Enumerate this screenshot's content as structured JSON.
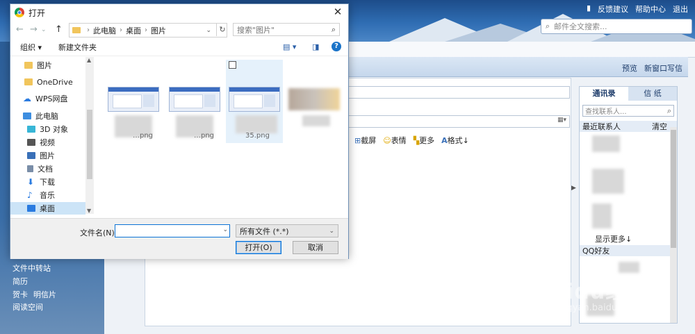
{
  "mail": {
    "header_links": [
      "反馈建议",
      "帮助中心",
      "退出"
    ],
    "search_placeholder": "邮件全文搜索...",
    "toolbar_right": [
      "预览",
      "新窗口写信"
    ],
    "format_tools": [
      "截屏",
      "表情",
      "更多",
      "格式"
    ],
    "left_links": [
      "文件中转站",
      "简历",
      "贺卡",
      "明信片",
      "阅读空间"
    ]
  },
  "contacts_panel": {
    "tabs": [
      "通讯录",
      "信 纸"
    ],
    "search_placeholder": "查找联系人...",
    "recent_label": "最近联系人",
    "clear_label": "清空",
    "show_more": "显示更多↓",
    "qq_friends": "QQ好友"
  },
  "dialog": {
    "title": "打开",
    "path": [
      "此电脑",
      "桌面",
      "图片"
    ],
    "search_placeholder": "搜索\"图片\"",
    "organize": "组织 ▾",
    "new_folder": "新建文件夹",
    "nav_items": [
      {
        "label": "图片",
        "icon": "folder-icon",
        "color": "#f1c55c"
      },
      {
        "label": "OneDrive",
        "icon": "folder-icon",
        "color": "#f1c55c"
      },
      {
        "label": "WPS网盘",
        "icon": "cloud-icon",
        "color": "#2a7be0"
      },
      {
        "label": "此电脑",
        "icon": "computer-icon",
        "color": "#3d8ee0"
      },
      {
        "label": "3D 对象",
        "icon": "cube-icon",
        "color": "#38b6d6"
      },
      {
        "label": "视频",
        "icon": "video-icon",
        "color": "#555555"
      },
      {
        "label": "图片",
        "icon": "picture-icon",
        "color": "#3a70b8"
      },
      {
        "label": "文档",
        "icon": "document-icon",
        "color": "#7a8ea8"
      },
      {
        "label": "下载",
        "icon": "download-icon",
        "color": "#2a7be0"
      },
      {
        "label": "音乐",
        "icon": "music-icon",
        "color": "#2a7be0"
      },
      {
        "label": "桌面",
        "icon": "desktop-icon",
        "color": "#2a7be0"
      }
    ],
    "files": [
      {
        "caption": "…png"
      },
      {
        "caption": "…png"
      },
      {
        "caption": "35.png"
      },
      {
        "caption": ""
      }
    ],
    "filename_label": "文件名(N):",
    "filename_value": "",
    "filetype": "所有文件 (*.*)",
    "open_button": "打开(O)",
    "cancel_button": "取消"
  },
  "watermark": {
    "brand": "Baidu经验",
    "url": "jingyan.baidu.com"
  }
}
